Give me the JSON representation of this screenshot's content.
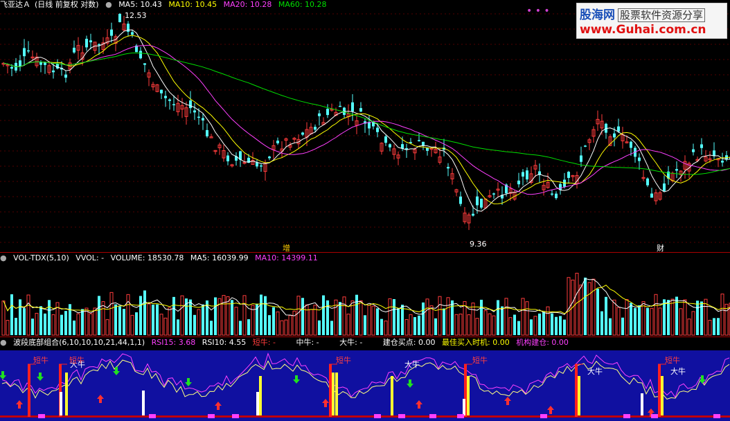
{
  "main": {
    "stock_name": "飞亚达Ａ",
    "period_desc": "(日线 前复权 对数)",
    "ma5_label": "MA5: 10.43",
    "ma10_label": "MA10: 10.45",
    "ma20_label": "MA20: 10.28",
    "ma60_label": "MA60: 10.28",
    "high_label": "12.53",
    "low_label": "9.36",
    "event_1": "增",
    "event_2": "财",
    "dots": "• • •"
  },
  "volume": {
    "indicator": "VOL-TDX(5,10)",
    "vvol": "VVOL: -",
    "volume_label": "VOLUME: 18530.78",
    "ma5_label": "MA5: 16039.99",
    "ma10_label": "MA10: 14399.11"
  },
  "indicator": {
    "name": "波段底部组合(6,10,10,10,21,44,1,1)",
    "rsi15": "RSI15: 3.68",
    "rsi10": "RSI10: 4.55",
    "short_bull": "短牛: -",
    "mid_bull": "中牛: -",
    "big_bull": "大牛: -",
    "build_buy": "建仓买点: 0.00",
    "best_time": "最佳买入时机: 0.00",
    "inst_build": "机构建仓: 0.00",
    "tag_short": "短牛",
    "tag_big": "大牛"
  },
  "watermark": {
    "brand": "股海网",
    "slogan": "股票软件资源分享",
    "url": "www.Guhai.com.cn"
  },
  "colors": {
    "up": "#ff3c3c",
    "down": "#54ffff",
    "ma5": "#ffffff",
    "ma10": "#ffff00",
    "ma20": "#ff40ff",
    "ma60": "#00e000",
    "indicator_bg": "#1010a0"
  }
}
